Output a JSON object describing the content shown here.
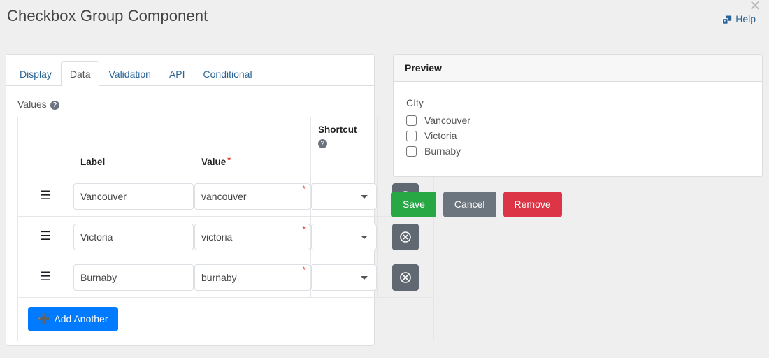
{
  "header": {
    "title": "Checkbox Group Component",
    "help_label": "Help",
    "help_icon": "clone-icon",
    "close_icon": "close-icon"
  },
  "tabs": [
    {
      "label": "Display",
      "active": false
    },
    {
      "label": "Data",
      "active": true
    },
    {
      "label": "Validation",
      "active": false
    },
    {
      "label": "API",
      "active": false
    },
    {
      "label": "Conditional",
      "active": false
    }
  ],
  "values_section": {
    "label": "Values",
    "help_icon": "question-circle-icon",
    "columns": {
      "handle": "",
      "label": "Label",
      "value": "Value",
      "value_required_mark": "*",
      "shortcut": "Shortcut",
      "shortcut_help_icon": "question-circle-icon",
      "action": ""
    },
    "rows": [
      {
        "handle_icon": "bars-drag-handle-icon",
        "label": "Vancouver",
        "value": "vancouver",
        "value_required_mark": "*",
        "shortcut": "",
        "remove_icon": "times-circle-icon"
      },
      {
        "handle_icon": "bars-drag-handle-icon",
        "label": "Victoria",
        "value": "victoria",
        "value_required_mark": "*",
        "shortcut": "",
        "remove_icon": "times-circle-icon"
      },
      {
        "handle_icon": "bars-drag-handle-icon",
        "label": "Burnaby",
        "value": "burnaby",
        "value_required_mark": "*",
        "shortcut": "",
        "remove_icon": "times-circle-icon"
      }
    ],
    "add_another_label": "Add Another",
    "add_another_icon": "plus-icon"
  },
  "preview": {
    "title": "Preview",
    "field_label": "CIty",
    "options": [
      {
        "label": "Vancouver",
        "checked": false
      },
      {
        "label": "Victoria",
        "checked": false
      },
      {
        "label": "Burnaby",
        "checked": false
      }
    ]
  },
  "actions": {
    "save": "Save",
    "cancel": "Cancel",
    "remove": "Remove"
  },
  "colors": {
    "page_background": "#efefef",
    "primary_blue": "#007bff",
    "link_blue": "#2a6496",
    "save_green": "#28a745",
    "cancel_gray": "#6c757d",
    "remove_red": "#dc3545",
    "row_button_gray": "#606872",
    "required_red": "#e03131"
  }
}
